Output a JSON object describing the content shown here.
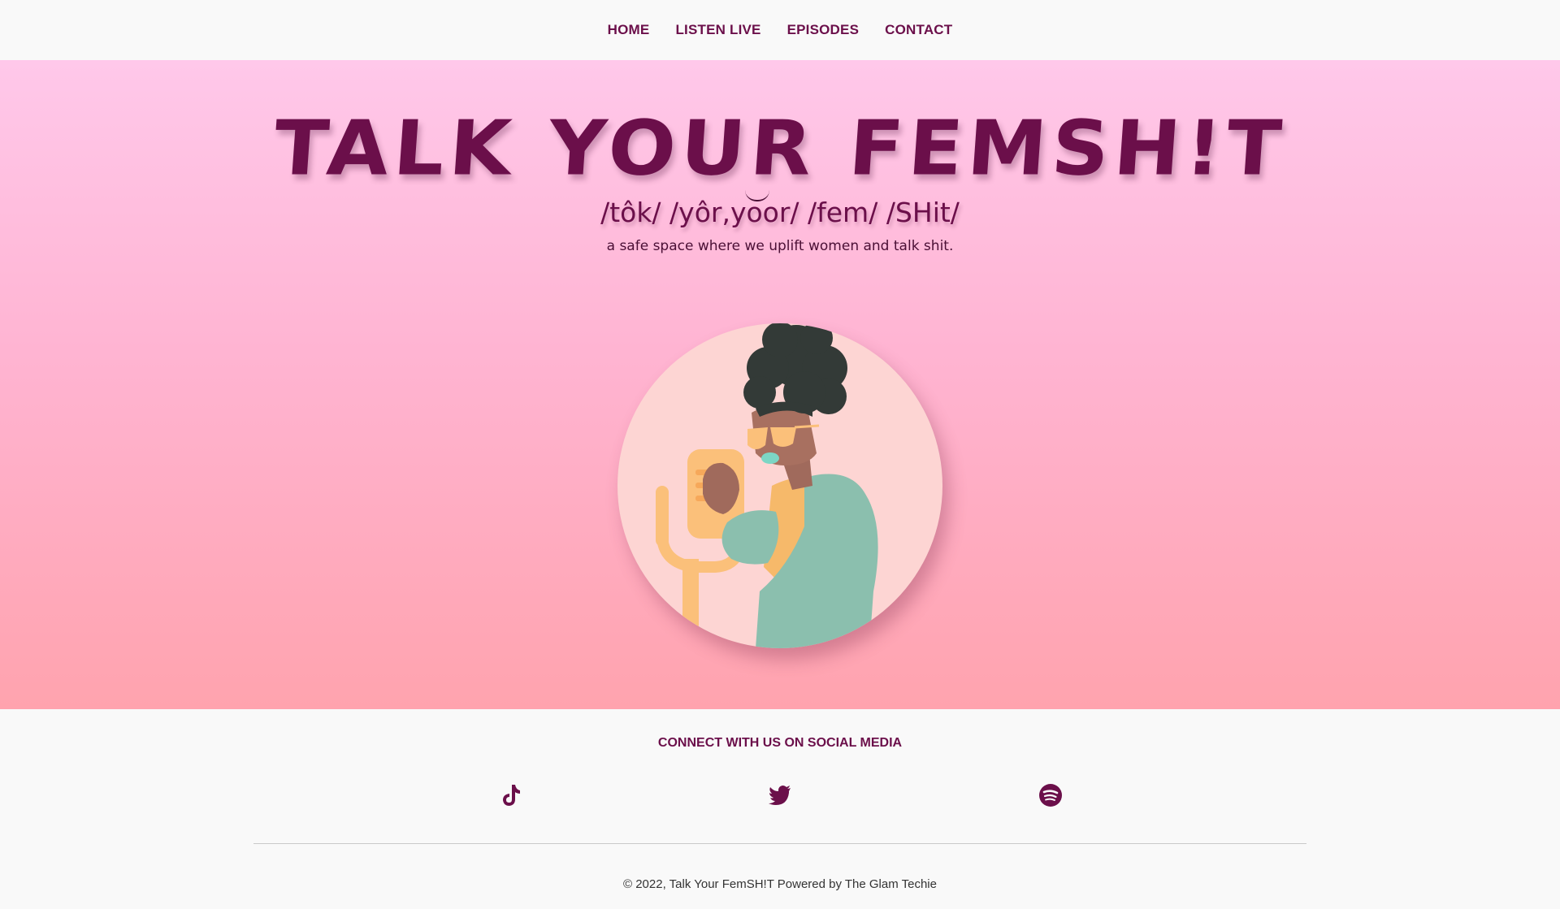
{
  "nav": {
    "items": [
      {
        "label": "HOME"
      },
      {
        "label": "LISTEN LIVE"
      },
      {
        "label": "EPISODES"
      },
      {
        "label": "CONTACT"
      }
    ]
  },
  "hero": {
    "title": "TALK YOUR FEMSH!T",
    "pronunciation": "/tôk/ /yôr,yoor/ /fem/ /SHit/",
    "tagline": "a safe space where we uplift women and talk shit."
  },
  "social": {
    "heading": "CONNECT WITH US ON SOCIAL MEDIA",
    "icons": [
      "tiktok-icon",
      "twitter-icon",
      "spotify-icon"
    ]
  },
  "footer": {
    "copyright": "© 2022, Talk Your FemSH!T Powered by The Glam Techie"
  },
  "colors": {
    "brand": "#6b0f4a",
    "hero_top": "#ffc8ea",
    "hero_bottom": "#ffa3ae",
    "background": "#f9f9f9"
  }
}
